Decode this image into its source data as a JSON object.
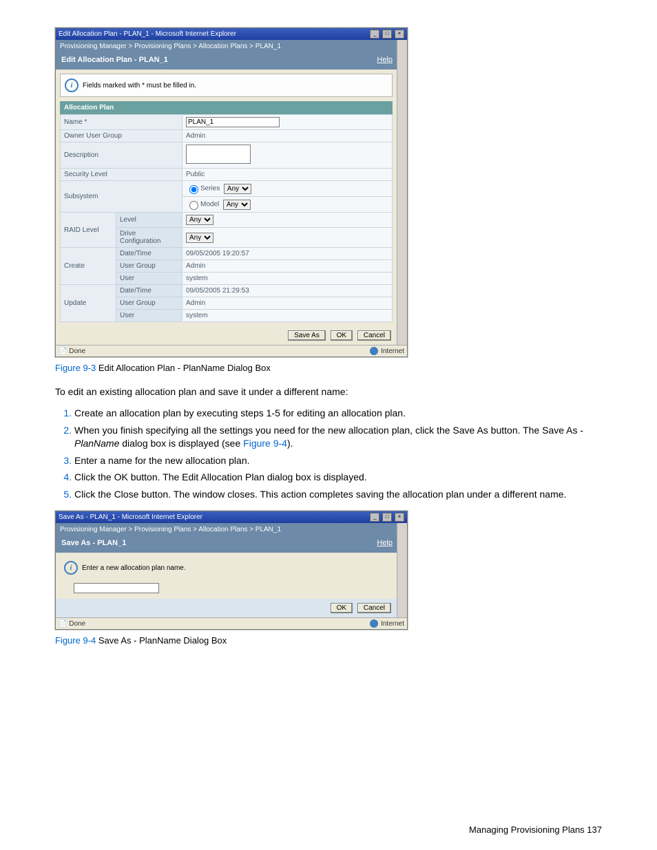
{
  "fig1": {
    "titlebar": "Edit Allocation Plan - PLAN_1 - Microsoft Internet Explorer",
    "breadcrumb": "Provisioning Manager > Provisioning Plans > Allocation Plans > PLAN_1",
    "subheader": "Edit Allocation Plan - PLAN_1",
    "help": "Help",
    "info": "Fields marked with * must be filled in.",
    "section": "Allocation Plan",
    "name_label": "Name *",
    "name_value": "PLAN_1",
    "owner_label": "Owner User Group",
    "owner_value": "Admin",
    "desc_label": "Description",
    "desc_value": "",
    "sec_label": "Security Level",
    "sec_value": "Public",
    "subsys_label": "Subsystem",
    "series_label": "Series",
    "model_label": "Model",
    "any": "Any",
    "raid_label": "RAID Level",
    "level_label": "Level",
    "drivecfg_label": "Drive Configuration",
    "create_label": "Create",
    "update_label": "Update",
    "dt_label": "Date/Time",
    "ug_label": "User Group",
    "user_label": "User",
    "create_dt": "09/05/2005 19:20:57",
    "create_ug": "Admin",
    "create_user": "system",
    "update_dt": "09/05/2005 21:29:53",
    "update_ug": "Admin",
    "update_user": "system",
    "btn_saveas": "Save As",
    "btn_ok": "OK",
    "btn_cancel": "Cancel",
    "status_done": "Done",
    "status_net": "Internet"
  },
  "fig2": {
    "titlebar": "Save As - PLAN_1 - Microsoft Internet Explorer",
    "breadcrumb": "Provisioning Manager > Provisioning Plans > Allocation Plans > PLAN_1",
    "subheader": "Save As - PLAN_1",
    "help": "Help",
    "info": "Enter a new allocation plan name.",
    "btn_ok": "OK",
    "btn_cancel": "Cancel",
    "status_done": "Done",
    "status_net": "Internet"
  },
  "captions": {
    "fig1_num": "Figure 9-3",
    "fig1_txt": " Edit Allocation Plan - PlanName Dialog Box",
    "fig2_num": "Figure 9-4",
    "fig2_txt": " Save As - PlanName Dialog Box"
  },
  "prose": {
    "lead": "To edit an existing allocation plan and save it under a different name:",
    "s1": "Create an allocation plan by executing steps 1-5 for editing an allocation plan.",
    "s2a": "When you finish specifying all the settings you need for the new allocation plan, click the Save As button. The Save As - ",
    "s2b": "PlanName",
    "s2c": " dialog box is displayed (see ",
    "s2link": "Figure 9-4",
    "s2d": ").",
    "s3": "Enter a name for the new allocation plan.",
    "s4": "Click the OK button. The Edit Allocation Plan dialog box is displayed.",
    "s5": "Click the Close button. The window closes. This action completes saving the allocation plan under a different name."
  },
  "footer": "Managing Provisioning Plans  137"
}
